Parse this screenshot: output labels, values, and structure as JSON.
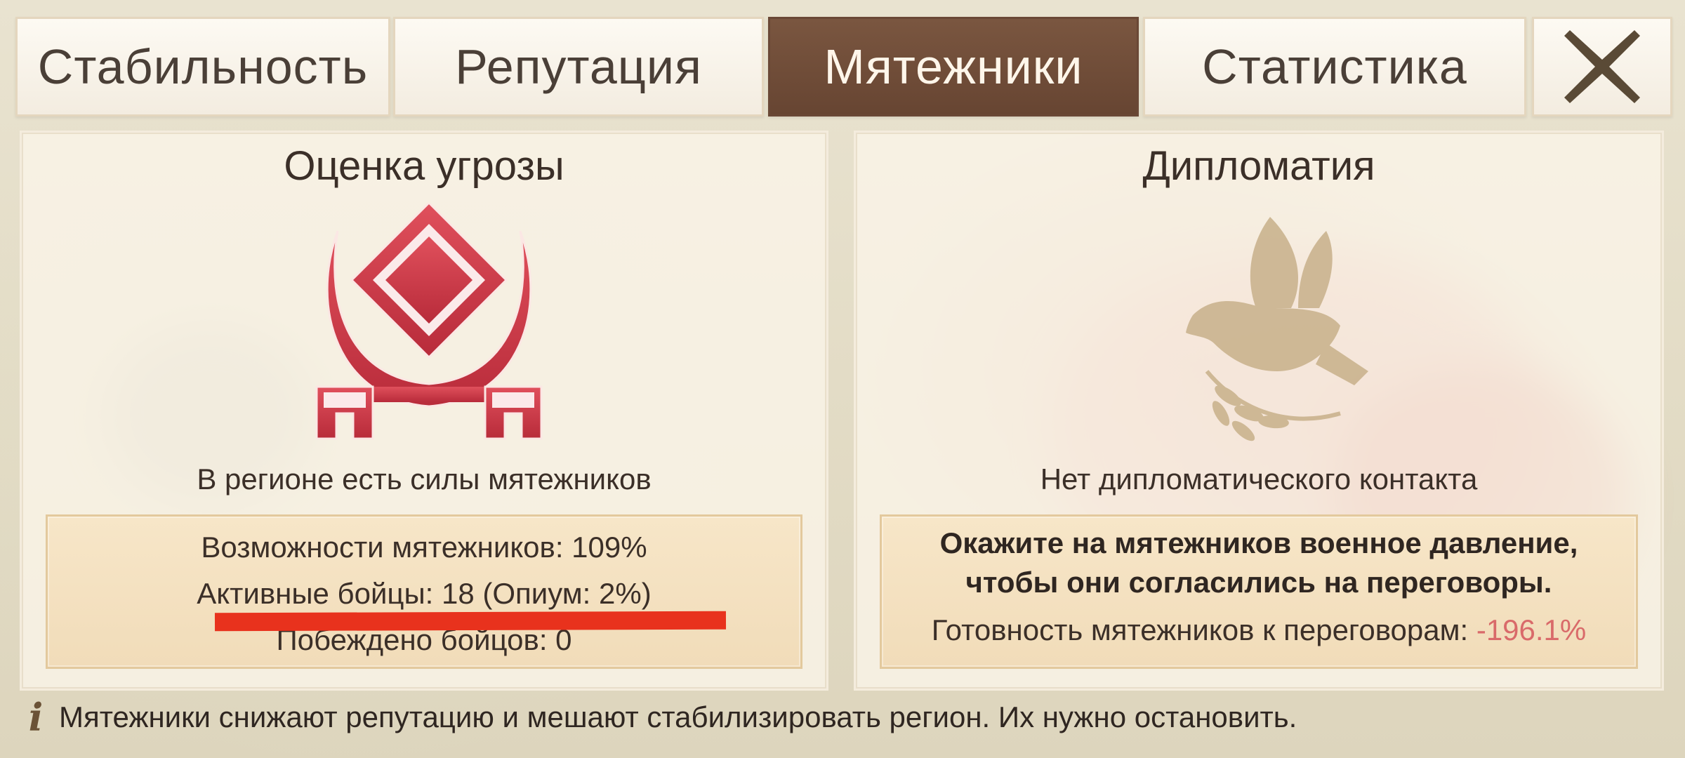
{
  "tabs": [
    {
      "label": "Стабильность",
      "active": false
    },
    {
      "label": "Репутация",
      "active": false
    },
    {
      "label": "Мятежники",
      "active": true
    },
    {
      "label": "Статистика",
      "active": false
    }
  ],
  "close_icon": "close-icon",
  "threat_panel": {
    "title": "Оценка угрозы",
    "emblem_icon": "rebel-emblem-icon",
    "status": "В регионе есть силы мятежников",
    "capabilities": "Возможности мятежников: 109%",
    "active_fighters": "Активные бойцы: 18 (Опиум: 2%)",
    "defeated_fighters": "Побеждено бойцов: 0"
  },
  "diplomacy_panel": {
    "title": "Дипломатия",
    "dove_icon": "dove-icon",
    "status": "Нет дипломатического контакта",
    "advice_line1": "Окажите на мятежников военное давление,",
    "advice_line2": "чтобы они согласились на переговоры.",
    "readiness_label": "Готовность мятежников к переговорам: ",
    "readiness_value": "-196.1%"
  },
  "footer": {
    "icon": "info-icon",
    "text": "Мятежники снижают репутацию и мешают стабилизировать регион. Их нужно остановить."
  },
  "colors": {
    "active_tab": "#6f4c38",
    "emblem_red": "#cf3846",
    "negative_value": "#d96a6a",
    "annotation_line": "#e8321d"
  }
}
